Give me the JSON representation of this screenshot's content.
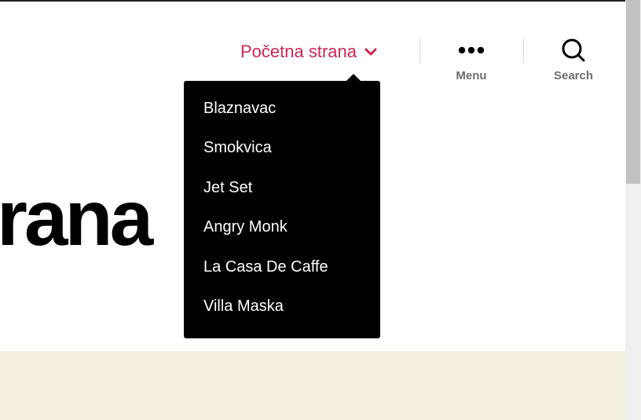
{
  "nav": {
    "active_label": "Početna strana",
    "active_color": "#cd2653",
    "chevron_icon": "chevron-down-icon"
  },
  "dropdown": {
    "items": [
      "Blaznavac",
      "Smokvica",
      "Jet Set",
      "Angry Monk",
      "La Casa De Caffe",
      "Villa Maska"
    ]
  },
  "toggles": {
    "menu_label": "Menu",
    "menu_icon": "ellipsis-icon",
    "search_label": "Search",
    "search_icon": "search-icon"
  },
  "hero": {
    "title_visible": "rana",
    "band_color": "#f5efe0"
  }
}
